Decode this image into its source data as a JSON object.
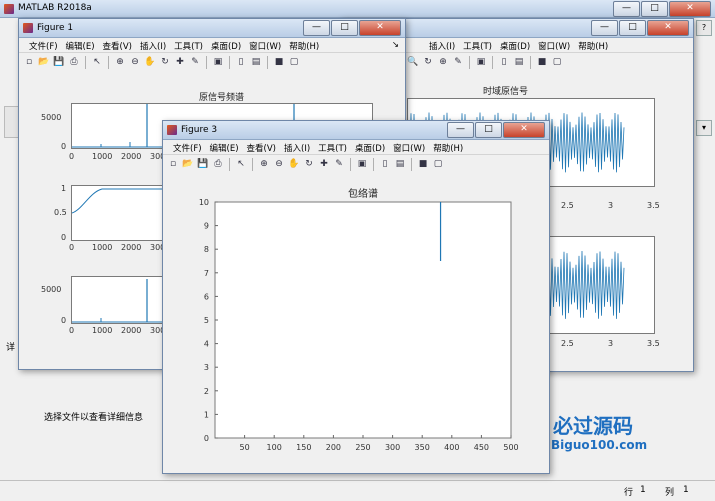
{
  "main_window": {
    "title": "MATLAB R2018a",
    "side_text": "选择文件以查看详细信息",
    "left_edge_text": "详",
    "status": {
      "row_label": "行",
      "row_value": "1",
      "col_label": "列",
      "col_value": "1"
    },
    "watermark": {
      "brand": "必过源码",
      "url": "Biguo100.com"
    }
  },
  "figure1": {
    "title": "Figure 1",
    "menu": [
      "文件(F)",
      "编辑(E)",
      "查看(V)",
      "插入(I)",
      "工具(T)",
      "桌面(D)",
      "窗口(W)",
      "帮助(H)"
    ],
    "plot1": {
      "title": "原信号频谱",
      "yticks": [
        "5000",
        "0"
      ],
      "xticks": [
        "0",
        "1000",
        "2000",
        "300"
      ]
    },
    "plot2": {
      "yticks": [
        "1",
        "0.5",
        "0"
      ],
      "xticks": [
        "0",
        "1000",
        "2000",
        "300"
      ]
    },
    "plot3": {
      "yticks": [
        "5000",
        "0"
      ],
      "xticks": [
        "0",
        "1000",
        "2000",
        "300"
      ]
    }
  },
  "figure2": {
    "menu": [
      "插入(I)",
      "工具(T)",
      "桌面(D)",
      "窗口(W)",
      "帮助(H)"
    ],
    "plot1": {
      "title": "时域原信号",
      "xticks": [
        "2.5",
        "3",
        "3.5"
      ]
    },
    "plot2": {
      "xticks": [
        "2.5",
        "3",
        "3.5"
      ]
    }
  },
  "figure3": {
    "title": "Figure 3",
    "menu": [
      "文件(F)",
      "编辑(E)",
      "查看(V)",
      "插入(I)",
      "工具(T)",
      "桌面(D)",
      "窗口(W)",
      "帮助(H)"
    ],
    "plot": {
      "title": "包络谱"
    }
  },
  "chart_data": {
    "type": "line",
    "title": "包络谱",
    "xlabel": "",
    "ylabel": "",
    "xlim": [
      0,
      500
    ],
    "ylim": [
      0,
      10
    ],
    "xticks": [
      50,
      100,
      150,
      200,
      250,
      300,
      350,
      400,
      450,
      500
    ],
    "yticks": [
      0,
      1,
      2,
      3,
      4,
      5,
      6,
      7,
      8,
      9,
      10
    ],
    "series": [
      {
        "x": [
          381,
          381
        ],
        "y": [
          7.5,
          10
        ]
      }
    ],
    "grid": false
  }
}
